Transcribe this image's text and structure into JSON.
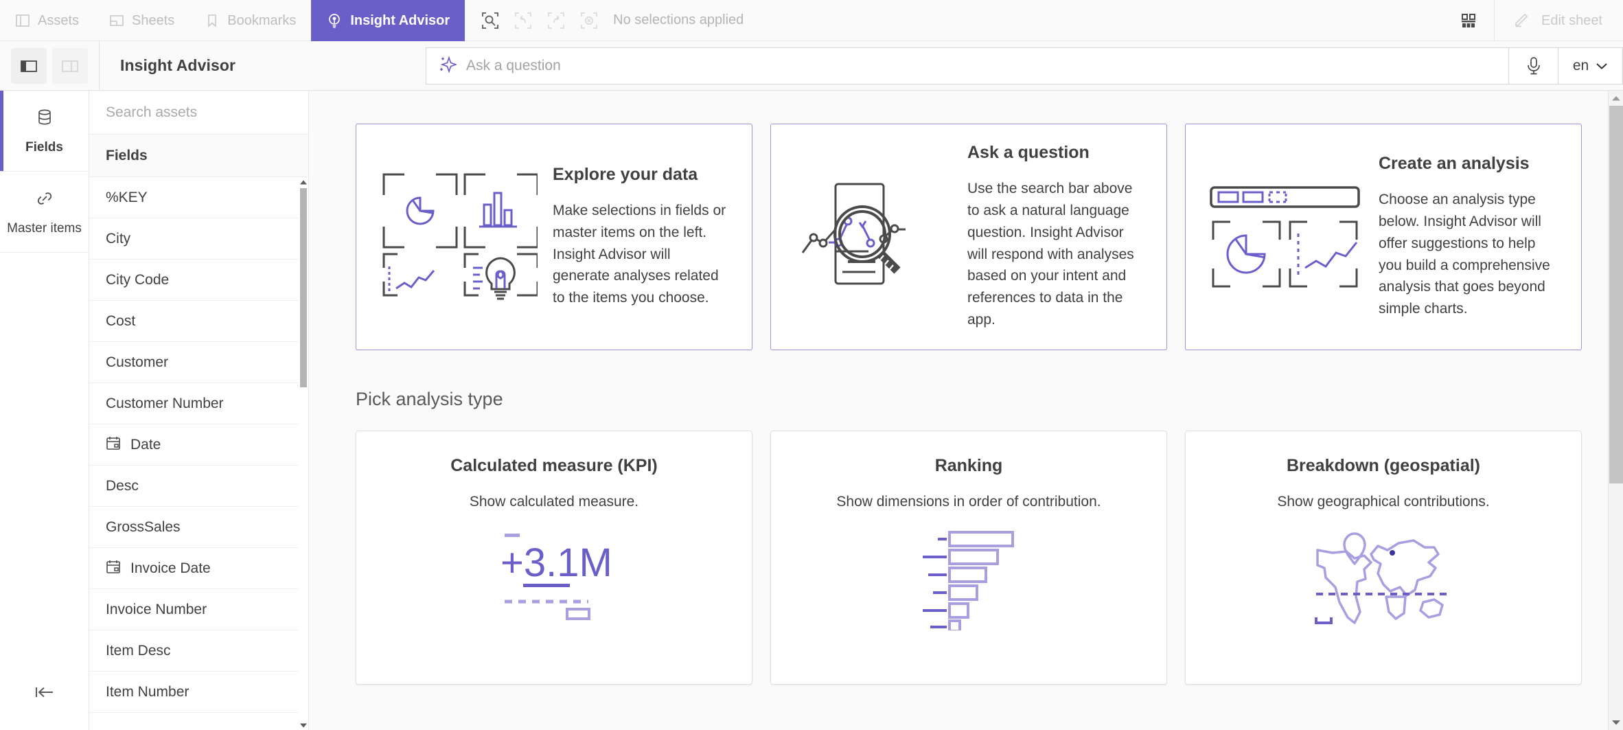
{
  "topbar": {
    "nav": [
      {
        "label": "Assets",
        "icon": "assets-panel-icon",
        "active": false
      },
      {
        "label": "Sheets",
        "icon": "sheets-icon",
        "active": false
      },
      {
        "label": "Bookmarks",
        "icon": "bookmark-icon",
        "active": false
      },
      {
        "label": "Insight Advisor",
        "icon": "insight-advisor-bulb-icon",
        "active": true
      }
    ],
    "selection_tools": [
      {
        "name": "selections-search-icon"
      },
      {
        "name": "step-back-icon"
      },
      {
        "name": "step-forward-icon"
      },
      {
        "name": "clear-selections-icon"
      }
    ],
    "selection_status": "No selections applied",
    "sheet_grid_icon": "sheet-grid-icon",
    "edit_sheet_label": "Edit sheet",
    "edit_sheet_icon": "pencil-icon",
    "accent_color": "#6A5FC9"
  },
  "subbar": {
    "toggle_left_panel_icon": "left-panel-toggle-icon",
    "toggle_right_panel_icon": "right-panel-toggle-icon",
    "title": "Insight Advisor",
    "search": {
      "placeholder": "Ask a question",
      "value": "",
      "sparkle_icon": "insight-sparkle-icon",
      "mic_icon": "microphone-icon"
    },
    "language": {
      "value": "en",
      "chevron_icon": "chevron-down-icon"
    }
  },
  "rail": {
    "items": [
      {
        "label": "Fields",
        "icon": "database-cylinder-icon",
        "active": true
      },
      {
        "label": "Master items",
        "icon": "link-chain-icon",
        "active": false
      }
    ],
    "collapse_icon": "collapse-left-icon"
  },
  "assets": {
    "search_placeholder": "Search assets",
    "search_value": "",
    "section_header": "Fields",
    "fields": [
      {
        "name": "%KEY",
        "icon": null
      },
      {
        "name": "City",
        "icon": null
      },
      {
        "name": "City Code",
        "icon": null
      },
      {
        "name": "Cost",
        "icon": null
      },
      {
        "name": "Customer",
        "icon": null
      },
      {
        "name": "Customer Number",
        "icon": null
      },
      {
        "name": "Date",
        "icon": "calendar-icon"
      },
      {
        "name": "Desc",
        "icon": null
      },
      {
        "name": "GrossSales",
        "icon": null
      },
      {
        "name": "Invoice Date",
        "icon": "calendar-icon"
      },
      {
        "name": "Invoice Number",
        "icon": null
      },
      {
        "name": "Item Desc",
        "icon": null
      },
      {
        "name": "Item Number",
        "icon": null
      }
    ],
    "scroll_up_icon": "scroll-up-arrow-icon",
    "scroll_down_icon": "scroll-down-arrow-icon"
  },
  "main": {
    "intro_cards": [
      {
        "title": "Explore your data",
        "description": "Make selections in fields or master items on the left. Insight Advisor will generate analyses related to the items you choose.",
        "art": "explore-data-illustration"
      },
      {
        "title": "Ask a question",
        "description": "Use the search bar above to ask a natural language question. Insight Advisor will respond with analyses based on your intent and references to data in the app.",
        "art": "magnifier-chart-illustration"
      },
      {
        "title": "Create an analysis",
        "description": "Choose an analysis type below. Insight Advisor will offer suggestions to help you build a comprehensive analysis that goes beyond simple charts.",
        "art": "create-analysis-illustration"
      }
    ],
    "pick_analysis_heading": "Pick analysis type",
    "analysis_types": [
      {
        "title": "Calculated measure (KPI)",
        "description": "Show calculated measure.",
        "art": "kpi-illustration",
        "kpi_value": "+3.1M"
      },
      {
        "title": "Ranking",
        "description": "Show dimensions in order of contribution.",
        "art": "ranking-bars-illustration"
      },
      {
        "title": "Breakdown (geospatial)",
        "description": "Show geographical contributions.",
        "art": "world-map-illustration"
      }
    ],
    "scroll_up_icon": "scroll-up-arrow-icon",
    "scroll_down_icon": "scroll-down-arrow-icon"
  }
}
